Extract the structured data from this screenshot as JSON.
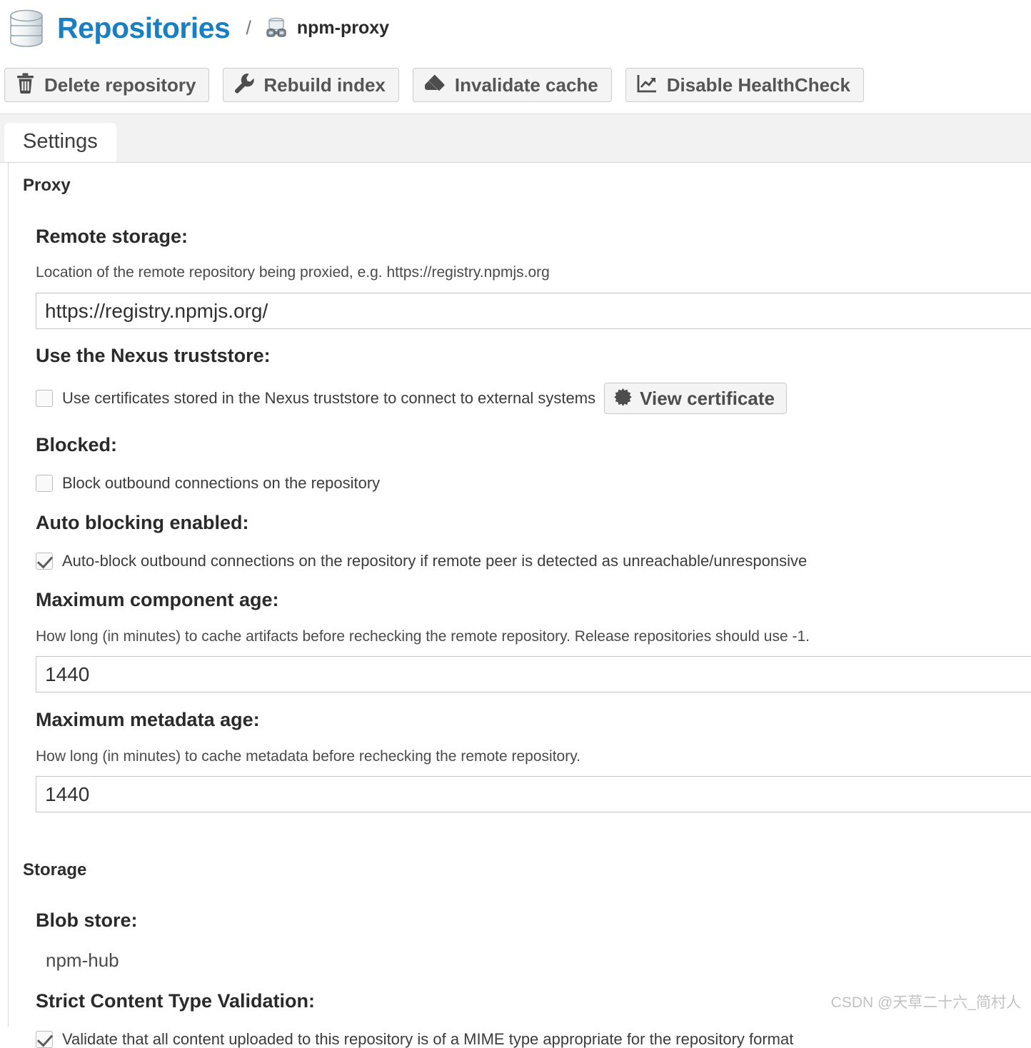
{
  "header": {
    "db_icon": "database-icon",
    "title": "Repositories",
    "separator": "/",
    "repo_icon": "repository-proxy-icon",
    "repo_name": "npm-proxy"
  },
  "toolbar": {
    "buttons": [
      {
        "label": "Delete repository",
        "icon": "trash-icon"
      },
      {
        "label": "Rebuild index",
        "icon": "wrench-icon"
      },
      {
        "label": "Invalidate cache",
        "icon": "eraser-icon"
      },
      {
        "label": "Disable HealthCheck",
        "icon": "chart-line-icon"
      }
    ]
  },
  "tabs": [
    {
      "label": "Settings",
      "active": true
    }
  ],
  "sections": {
    "proxy": {
      "title": "Proxy",
      "remote_storage": {
        "label": "Remote storage:",
        "help": "Location of the remote repository being proxied, e.g. https://registry.npmjs.org",
        "value": "https://registry.npmjs.org/",
        "placeholder": ""
      },
      "truststore": {
        "label": "Use the Nexus truststore:",
        "checkbox_label": "Use certificates stored in the Nexus truststore to connect to external systems",
        "checked": false,
        "button_label": "View certificate",
        "button_icon": "certificate-seal-icon"
      },
      "blocked": {
        "label": "Blocked:",
        "checkbox_label": "Block outbound connections on the repository",
        "checked": false
      },
      "auto_blocking": {
        "label": "Auto blocking enabled:",
        "checkbox_label": "Auto-block outbound connections on the repository if remote peer is detected as unreachable/unresponsive",
        "checked": true
      },
      "max_component_age": {
        "label": "Maximum component age:",
        "help": "How long (in minutes) to cache artifacts before rechecking the remote repository. Release repositories should use -1.",
        "value": "1440"
      },
      "max_metadata_age": {
        "label": "Maximum metadata age:",
        "help": "How long (in minutes) to cache metadata before rechecking the remote repository.",
        "value": "1440"
      }
    },
    "storage": {
      "title": "Storage",
      "blob_store": {
        "label": "Blob store:",
        "value": "npm-hub"
      },
      "strict_content": {
        "label": "Strict Content Type Validation:",
        "checkbox_label": "Validate that all content uploaded to this repository is of a MIME type appropriate for the repository format",
        "checked": true
      }
    }
  },
  "watermark": "CSDN @天草二十六_简村人",
  "colors": {
    "brand_blue": "#1a7fc1",
    "panel_bg": "#ffffff",
    "tabstrip_bg": "#f2f2f2",
    "button_bg": "#f4f4f4"
  }
}
